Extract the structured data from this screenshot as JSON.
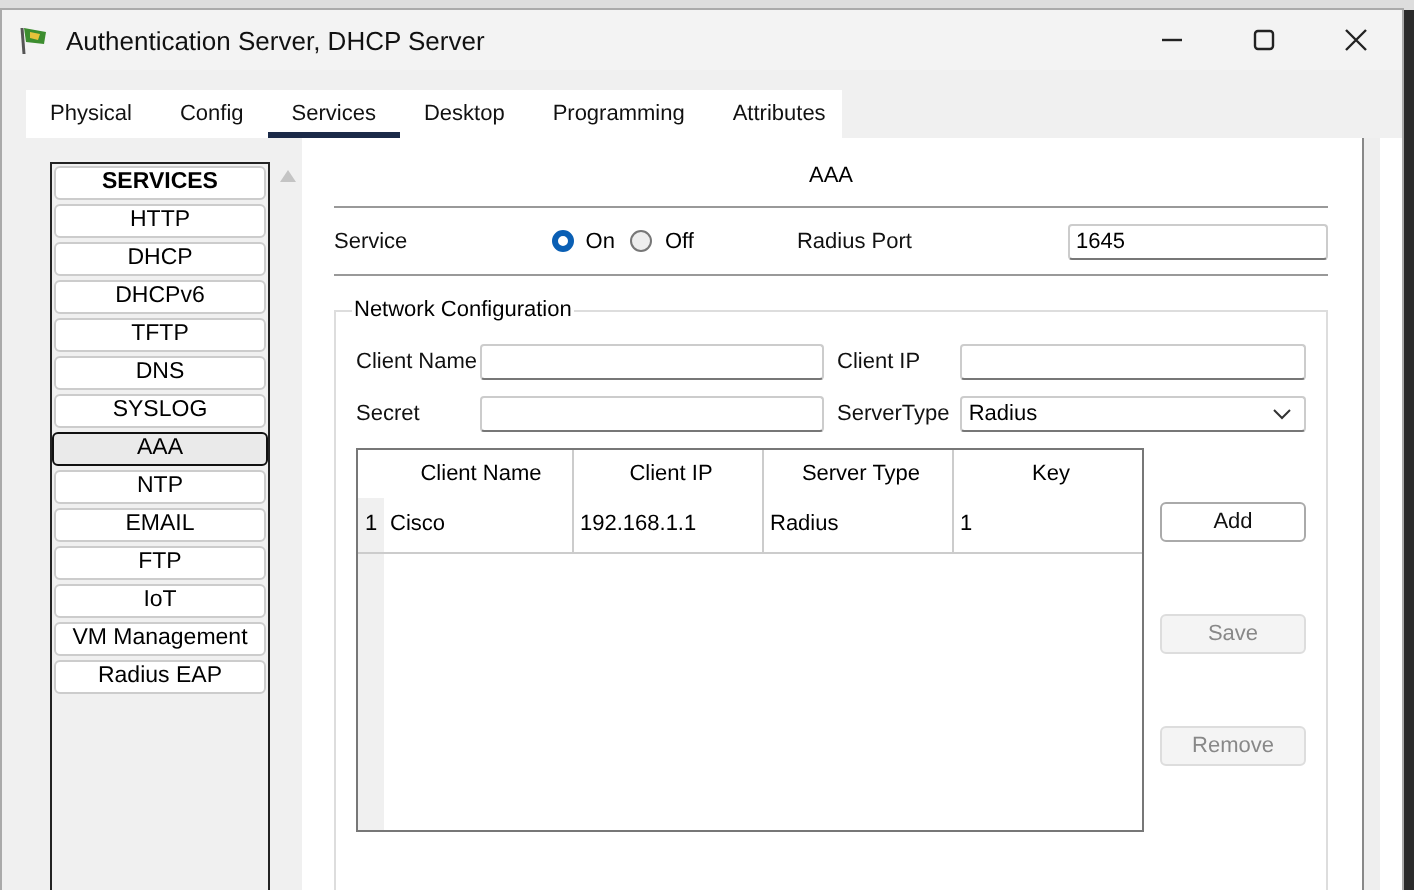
{
  "window": {
    "title": "Authentication Server, DHCP Server"
  },
  "tabs": [
    {
      "label": "Physical",
      "selected": false
    },
    {
      "label": "Config",
      "selected": false
    },
    {
      "label": "Services",
      "selected": true
    },
    {
      "label": "Desktop",
      "selected": false
    },
    {
      "label": "Programming",
      "selected": false
    },
    {
      "label": "Attributes",
      "selected": false
    }
  ],
  "sidebar": {
    "heading": "SERVICES",
    "items": [
      {
        "label": "HTTP",
        "selected": false
      },
      {
        "label": "DHCP",
        "selected": false
      },
      {
        "label": "DHCPv6",
        "selected": false
      },
      {
        "label": "TFTP",
        "selected": false
      },
      {
        "label": "DNS",
        "selected": false
      },
      {
        "label": "SYSLOG",
        "selected": false
      },
      {
        "label": "AAA",
        "selected": true
      },
      {
        "label": "NTP",
        "selected": false
      },
      {
        "label": "EMAIL",
        "selected": false
      },
      {
        "label": "FTP",
        "selected": false
      },
      {
        "label": "IoT",
        "selected": false
      },
      {
        "label": "VM Management",
        "selected": false
      },
      {
        "label": "Radius EAP",
        "selected": false
      }
    ]
  },
  "panel": {
    "title": "AAA",
    "service_label": "Service",
    "service_options": [
      {
        "label": "On",
        "selected": true
      },
      {
        "label": "Off",
        "selected": false
      }
    ],
    "radius_port_label": "Radius Port",
    "radius_port_value": "1645",
    "group": {
      "title": "Network Configuration",
      "client_name_label": "Client Name",
      "client_ip_label": "Client IP",
      "secret_label": "Secret",
      "server_type_label": "ServerType",
      "server_type_value": "Radius"
    },
    "table": {
      "columns": [
        "Client Name",
        "Client IP",
        "Server Type",
        "Key"
      ],
      "rows": [
        {
          "index": "1",
          "cells": [
            "Cisco",
            "192.168.1.1",
            "Radius",
            "1"
          ]
        }
      ]
    },
    "buttons": [
      {
        "label": "Add",
        "disabled": false
      },
      {
        "label": "Save",
        "disabled": true
      },
      {
        "label": "Remove",
        "disabled": true
      }
    ]
  }
}
